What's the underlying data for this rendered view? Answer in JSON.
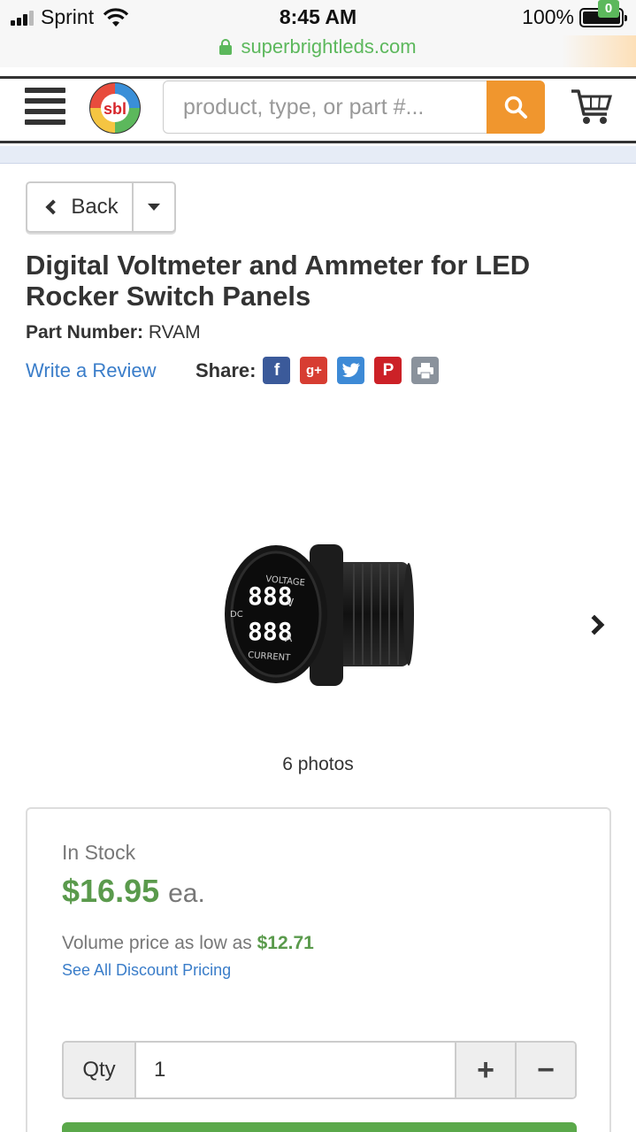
{
  "status_bar": {
    "carrier": "Sprint",
    "time": "8:45 AM",
    "battery": "100%"
  },
  "browser": {
    "url": "superbrightleds.com"
  },
  "header": {
    "search_placeholder": "product, type, or part #...",
    "cart_count": "0",
    "logo_text": "sbl"
  },
  "nav": {
    "back_label": "Back"
  },
  "product": {
    "title": "Digital Voltmeter and Ammeter for LED Rocker Switch Panels",
    "part_number_label": "Part Number:",
    "part_number": "RVAM",
    "write_review": "Write a Review",
    "share_label": "Share:",
    "photos_count": "6 photos",
    "image_labels": {
      "voltage": "VOLTAGE",
      "current": "CURRENT",
      "dc": "DC",
      "v": "V",
      "a": "A",
      "digits": "888"
    }
  },
  "purchase": {
    "stock": "In Stock",
    "price": "$16.95",
    "unit": "ea.",
    "volume_text": "Volume price as low as",
    "volume_price": "$12.71",
    "discount_link": "See All Discount Pricing",
    "qty_label": "Qty",
    "qty_value": "1",
    "plus": "+",
    "minus": "−"
  },
  "colors": {
    "accent_orange": "#f0962e",
    "price_green": "#5a9a4c",
    "link_blue": "#3a7dc9"
  }
}
